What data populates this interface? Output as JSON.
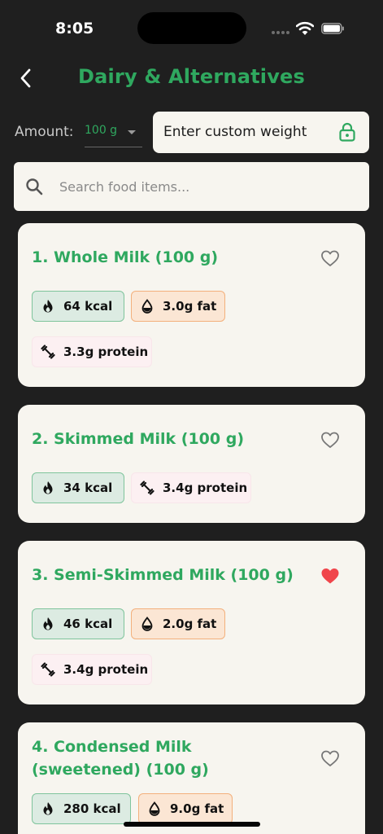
{
  "status_bar": {
    "time": "8:05"
  },
  "header": {
    "title": "Dairy & Alternatives"
  },
  "amount": {
    "label": "Amount:",
    "value": "100 g"
  },
  "custom_weight": {
    "label": "Enter custom weight"
  },
  "search": {
    "placeholder": "Search food items..."
  },
  "colors": {
    "accent": "#2fa85f",
    "background": "#1f1f1f",
    "card": "#f7f5ef",
    "heart_active": "#f0454b"
  },
  "foods": [
    {
      "title": "1. Whole Milk (100 g)",
      "kcal": "64 kcal",
      "fat": "3.0g fat",
      "protein": "3.3g protein",
      "favorite": false
    },
    {
      "title": "2. Skimmed Milk (100 g)",
      "kcal": "34 kcal",
      "protein": "3.4g protein",
      "favorite": false
    },
    {
      "title": "3. Semi-Skimmed Milk (100 g)",
      "kcal": "46 kcal",
      "fat": "2.0g fat",
      "protein": "3.4g protein",
      "favorite": true
    },
    {
      "title": "4. Condensed Milk (sweetened) (100 g)",
      "kcal": "280 kcal",
      "fat": "9.0g fat",
      "favorite": false
    }
  ]
}
